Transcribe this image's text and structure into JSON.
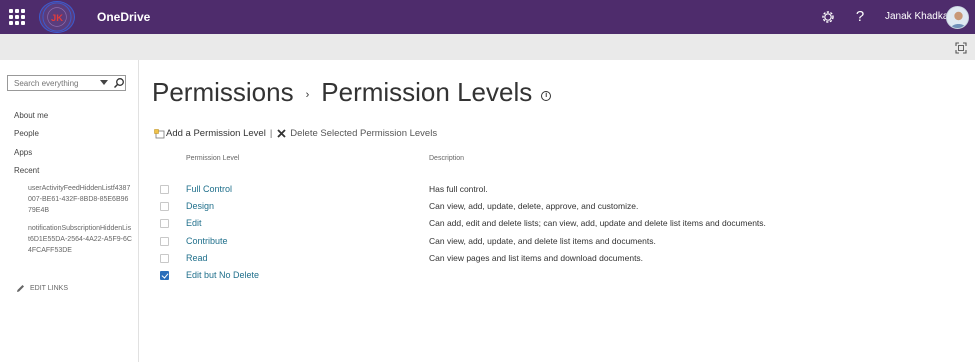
{
  "suite_bar": {
    "app_name": "OneDrive",
    "help_glyph": "?",
    "user_name": "Janak Khadka",
    "logo_text": "JK",
    "bg_color": "#4e2c6c"
  },
  "left_nav": {
    "search_placeholder": "Search everything",
    "items": [
      {
        "label": "About me"
      },
      {
        "label": "People"
      },
      {
        "label": "Apps"
      },
      {
        "label": "Recent"
      }
    ],
    "recent": [
      {
        "label": "userActivityFeedHiddenListf4387007-BE61-432F-8BD8-85E6B9679E4B"
      },
      {
        "label": "notificationSubscriptionHiddenList6D1E55DA-2564-4A22-A5F9-6C4FCAFF53DE"
      }
    ],
    "edit_links": "EDIT LINKS"
  },
  "main": {
    "breadcrumb_root": "Permissions",
    "breadcrumb_sep": "›",
    "breadcrumb_current": "Permission Levels",
    "info_glyph": "i",
    "toolbar": {
      "add_label": "Add a Permission Level",
      "pipe": "|",
      "delete_label": "Delete Selected Permission Levels"
    },
    "columns": {
      "level": "Permission Level",
      "description": "Description"
    },
    "rows": [
      {
        "level": "Full Control",
        "description": "Has full control.",
        "checked": false
      },
      {
        "level": "Design",
        "description": "Can view, add, update, delete, approve, and customize.",
        "checked": false
      },
      {
        "level": "Edit",
        "description": "Can add, edit and delete lists; can view, add, update and delete list items and documents.",
        "checked": false
      },
      {
        "level": "Contribute",
        "description": "Can view, add, update, and delete list items and documents.",
        "checked": false
      },
      {
        "level": "Read",
        "description": "Can view pages and list items and download documents.",
        "checked": false
      },
      {
        "level": "Edit but No Delete",
        "description": "",
        "checked": true
      }
    ]
  },
  "icons": {
    "app_launcher": "waffle-icon",
    "settings": "gear-icon",
    "help": "help-icon",
    "focus": "focus-mode-icon",
    "search": "search-icon",
    "dropdown": "chevron-down-icon",
    "edit": "pencil-icon",
    "add": "add-item-icon",
    "delete": "close-x-icon"
  }
}
